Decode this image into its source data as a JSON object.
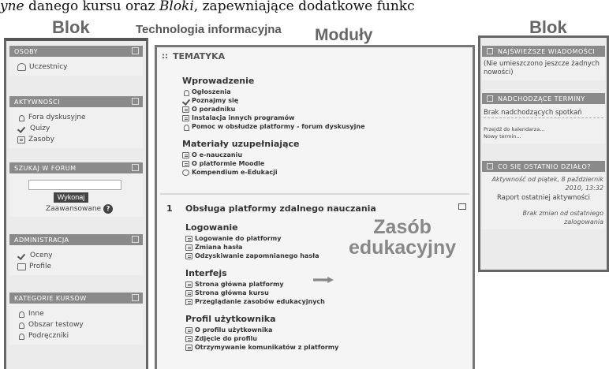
{
  "caption": {
    "prefix": "yne",
    "middle": " danego kursu oraz ",
    "italic2": "Bloki",
    "suffix": ", zapewniające dodatkowe funkc"
  },
  "overlay": {
    "blok_left": "Blok",
    "course": "Technologia informacyjna",
    "moduly": "Moduły",
    "blok_right": "Blok",
    "zasob": "Zasób",
    "edukacyjny": "edukacyjny"
  },
  "left": {
    "osoby": {
      "title": "OSOBY",
      "items": [
        "Uczestnicy"
      ]
    },
    "aktywnosci": {
      "title": "AKTYWNOŚCI",
      "items": [
        "Fora dyskusyjne",
        "Quizy",
        "Zasoby"
      ]
    },
    "szukaj": {
      "title": "SZUKAJ W FORUM",
      "button": "Wykonaj",
      "advanced": "Zaawansowane",
      "help": "?"
    },
    "admin": {
      "title": "ADMINISTRACJA",
      "items": [
        "Oceny",
        "Profile"
      ]
    },
    "kategorie": {
      "title": "KATEGORIE KURSÓW",
      "items": [
        "Inne",
        "Obszar testowy",
        "Podręczniki"
      ]
    }
  },
  "middle": {
    "header": "TEMATYKA",
    "drag_glyph": "::",
    "sec0": [
      {
        "heading": "Wprowadzenie",
        "items": [
          {
            "icon": "forum-icon",
            "label": "Ogłoszenia"
          },
          {
            "icon": "quiz-icon",
            "label": "Poznajmy się"
          },
          {
            "icon": "resource-icon",
            "label": "O poradniku"
          },
          {
            "icon": "resource-icon",
            "label": "Instalacja innych programów"
          },
          {
            "icon": "forum-icon",
            "label": "Pomoc w obsłudze platformy - forum dyskusyjne"
          }
        ]
      },
      {
        "heading": "Materiały uzupełniające",
        "items": [
          {
            "icon": "resource-icon",
            "label": "O e-nauczaniu"
          },
          {
            "icon": "resource-icon",
            "label": "O platformie Moodle"
          },
          {
            "icon": "globe-icon",
            "label": "Kompendium e-Edukacji"
          }
        ]
      }
    ],
    "sec1": {
      "number": "1",
      "title": "Obsługa platformy zdalnego nauczania",
      "groups": [
        {
          "heading": "Logowanie",
          "items": [
            "Logowanie do platformy",
            "Zmiana hasła",
            "Odzyskiwanie zapomnianego hasła"
          ]
        },
        {
          "heading": "Interfejs",
          "items": [
            "Strona główna platformy",
            "Strona główna kursu",
            "Przeglądanie zasobów edukacyjnych"
          ]
        },
        {
          "heading": "Profil użytkownika",
          "items": [
            "O profilu użytkownika",
            "Zdjęcie do profilu",
            "Otrzymywanie komunikatów z platformy"
          ]
        }
      ]
    }
  },
  "right": {
    "news": {
      "title": "NAJŚWIEŻSZE WIADOMOŚCI",
      "text": "(Nie umieszczono jeszcze żadnych nowości)"
    },
    "events": {
      "title": "NADCHODZĄCE TERMINY",
      "text": "Brak nadchodzących spotkań",
      "link1": "Przejdź do kalendarza...",
      "link2": "Nowy termin..."
    },
    "recent": {
      "title": "CO SIĘ OSTATNIO DZIAŁO?",
      "since": "Aktywność od piątek, 8 październik 2010, 13:32",
      "report": "Raport ostatniej aktywności",
      "nochange": "Brak zmian od ostatniego zalogowania"
    }
  }
}
